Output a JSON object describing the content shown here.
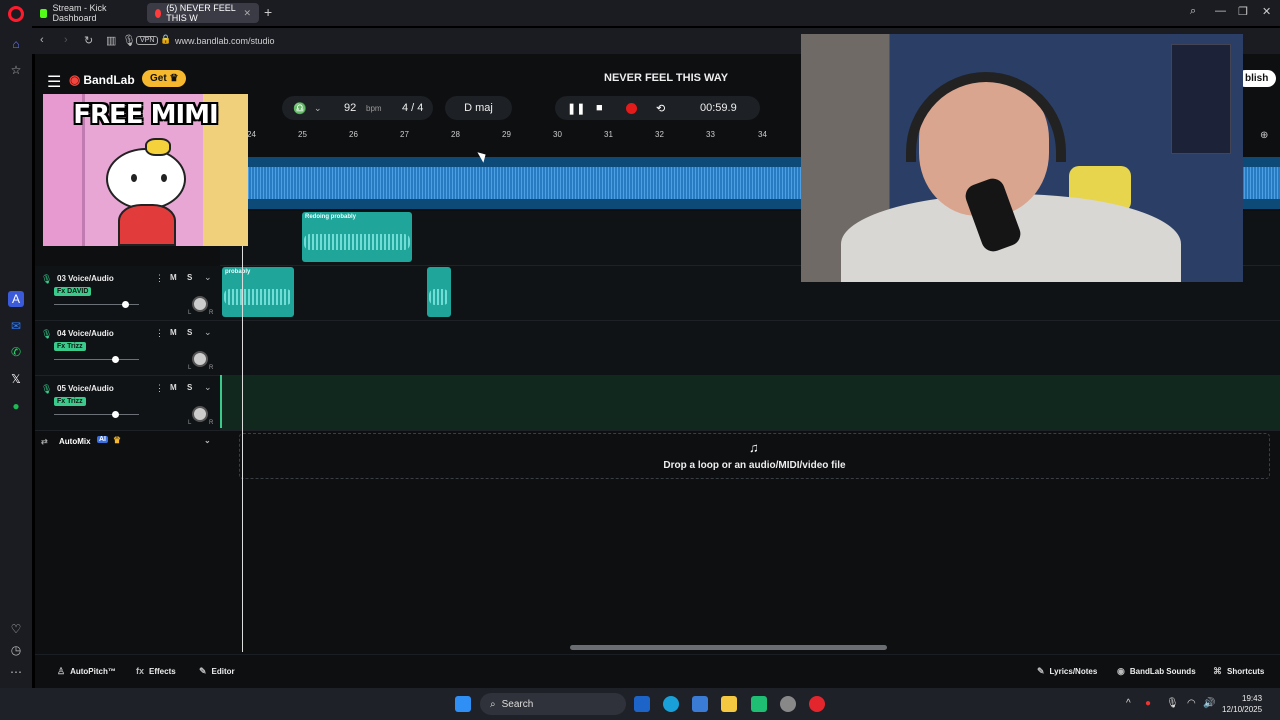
{
  "browser": {
    "tabs": [
      {
        "label": "Stream - Kick Dashboard",
        "color": "#53fc18"
      },
      {
        "label": "(5) NEVER FEEL THIS W",
        "color": "#ff3b3b"
      }
    ],
    "url": "www.bandlab.com/studio",
    "vpn": "VPN"
  },
  "app": {
    "brand": "BandLab",
    "get_label": "Get",
    "song_title": "NEVER FEEL THIS WAY",
    "publish_label": "blish",
    "bpm": "92",
    "bpm_unit": "bpm",
    "time_sig": "4 / 4",
    "key": "D maj",
    "time": "00:59.9",
    "accent": "#3acb8c"
  },
  "ruler": [
    "24",
    "25",
    "26",
    "27",
    "28",
    "29",
    "30",
    "31",
    "32",
    "33",
    "34"
  ],
  "tracks": [
    {
      "name": "03 Voice/Audio",
      "fx": "Fx DAVID",
      "m": "M",
      "s": "S",
      "volume": 0.59
    },
    {
      "name": "04 Voice/Audio",
      "fx": "Fx Trizz",
      "m": "M",
      "s": "S",
      "volume": 0.51
    },
    {
      "name": "05 Voice/Audio",
      "fx": "Fx Trizz",
      "m": "M",
      "s": "S",
      "volume": 0.51
    }
  ],
  "clips": {
    "redoing": "Redoing probably",
    "probably": "probably"
  },
  "pan": {
    "l": "L",
    "r": "R"
  },
  "automix": {
    "label": "AutoMix",
    "ai": "AI"
  },
  "dropzone": {
    "text": "Drop a loop or an audio/MIDI/video file"
  },
  "bottom": {
    "autopitch": "AutoPitch™",
    "effects": "Effects",
    "editor": "Editor",
    "lyrics": "Lyrics/Notes",
    "sounds": "BandLab Sounds",
    "shortcuts": "Shortcuts"
  },
  "overlay": {
    "meme_caption": "FREE MIMI"
  },
  "taskbar": {
    "search": "Search",
    "time": "19:43",
    "date": "12/10/2025"
  }
}
